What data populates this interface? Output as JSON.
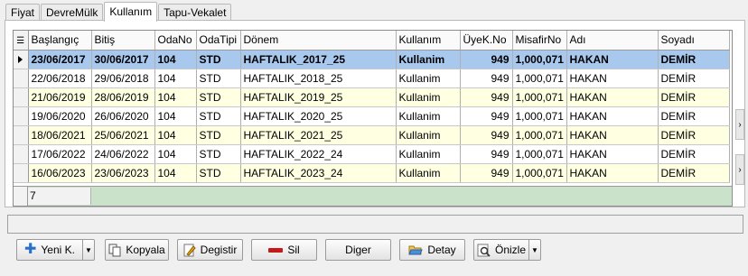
{
  "tabs": [
    "Fiyat",
    "DevreMülk",
    "Kullanım",
    "Tapu-Vekalet"
  ],
  "active_tab": 2,
  "columns": [
    "Başlangıç",
    "Bitiş",
    "OdaNo",
    "OdaTipi",
    "Dönem",
    "Kullanım",
    "ÜyeK.No",
    "MisafirNo",
    "Adı",
    "Soyadı"
  ],
  "rows": [
    [
      "23/06/2017",
      "30/06/2017",
      "104",
      "STD",
      "HAFTALIK_2017_25",
      "Kullanim",
      "949",
      "1,000,071",
      "HAKAN",
      "DEMİR"
    ],
    [
      "22/06/2018",
      "29/06/2018",
      "104",
      "STD",
      "HAFTALIK_2018_25",
      "Kullanim",
      "949",
      "1,000,071",
      "HAKAN",
      "DEMİR"
    ],
    [
      "21/06/2019",
      "28/06/2019",
      "104",
      "STD",
      "HAFTALIK_2019_25",
      "Kullanim",
      "949",
      "1,000,071",
      "HAKAN",
      "DEMİR"
    ],
    [
      "19/06/2020",
      "26/06/2020",
      "104",
      "STD",
      "HAFTALIK_2020_25",
      "Kullanim",
      "949",
      "1,000,071",
      "HAKAN",
      "DEMİR"
    ],
    [
      "18/06/2021",
      "25/06/2021",
      "104",
      "STD",
      "HAFTALIK_2021_25",
      "Kullanim",
      "949",
      "1,000,071",
      "HAKAN",
      "DEMİR"
    ],
    [
      "17/06/2022",
      "24/06/2022",
      "104",
      "STD",
      "HAFTALIK_2022_24",
      "Kullanim",
      "949",
      "1,000,071",
      "HAKAN",
      "DEMİR"
    ],
    [
      "16/06/2023",
      "23/06/2023",
      "104",
      "STD",
      "HAFTALIK_2023_24",
      "Kullanim",
      "949",
      "1,000,071",
      "HAKAN",
      "DEMİR"
    ]
  ],
  "selected_row": 0,
  "footer_count": "7",
  "buttons": {
    "new": "Yeni K.",
    "copy": "Kopyala",
    "edit": "Degistir",
    "delete": "Sil",
    "other": "Diger",
    "detail": "Detay",
    "preview": "Önizle"
  },
  "icons": {
    "new": "plus-icon",
    "copy": "copy-icon",
    "edit": "pencil-icon",
    "delete": "minus-icon",
    "detail": "folder-open-icon",
    "preview": "preview-icon",
    "column_chooser": "list-icon",
    "row_pointer": "triangle-right-icon"
  },
  "colors": {
    "selected_row": "#a9c8ee",
    "alt_row": "#ffffe1",
    "footer": "#c9e2c9"
  }
}
